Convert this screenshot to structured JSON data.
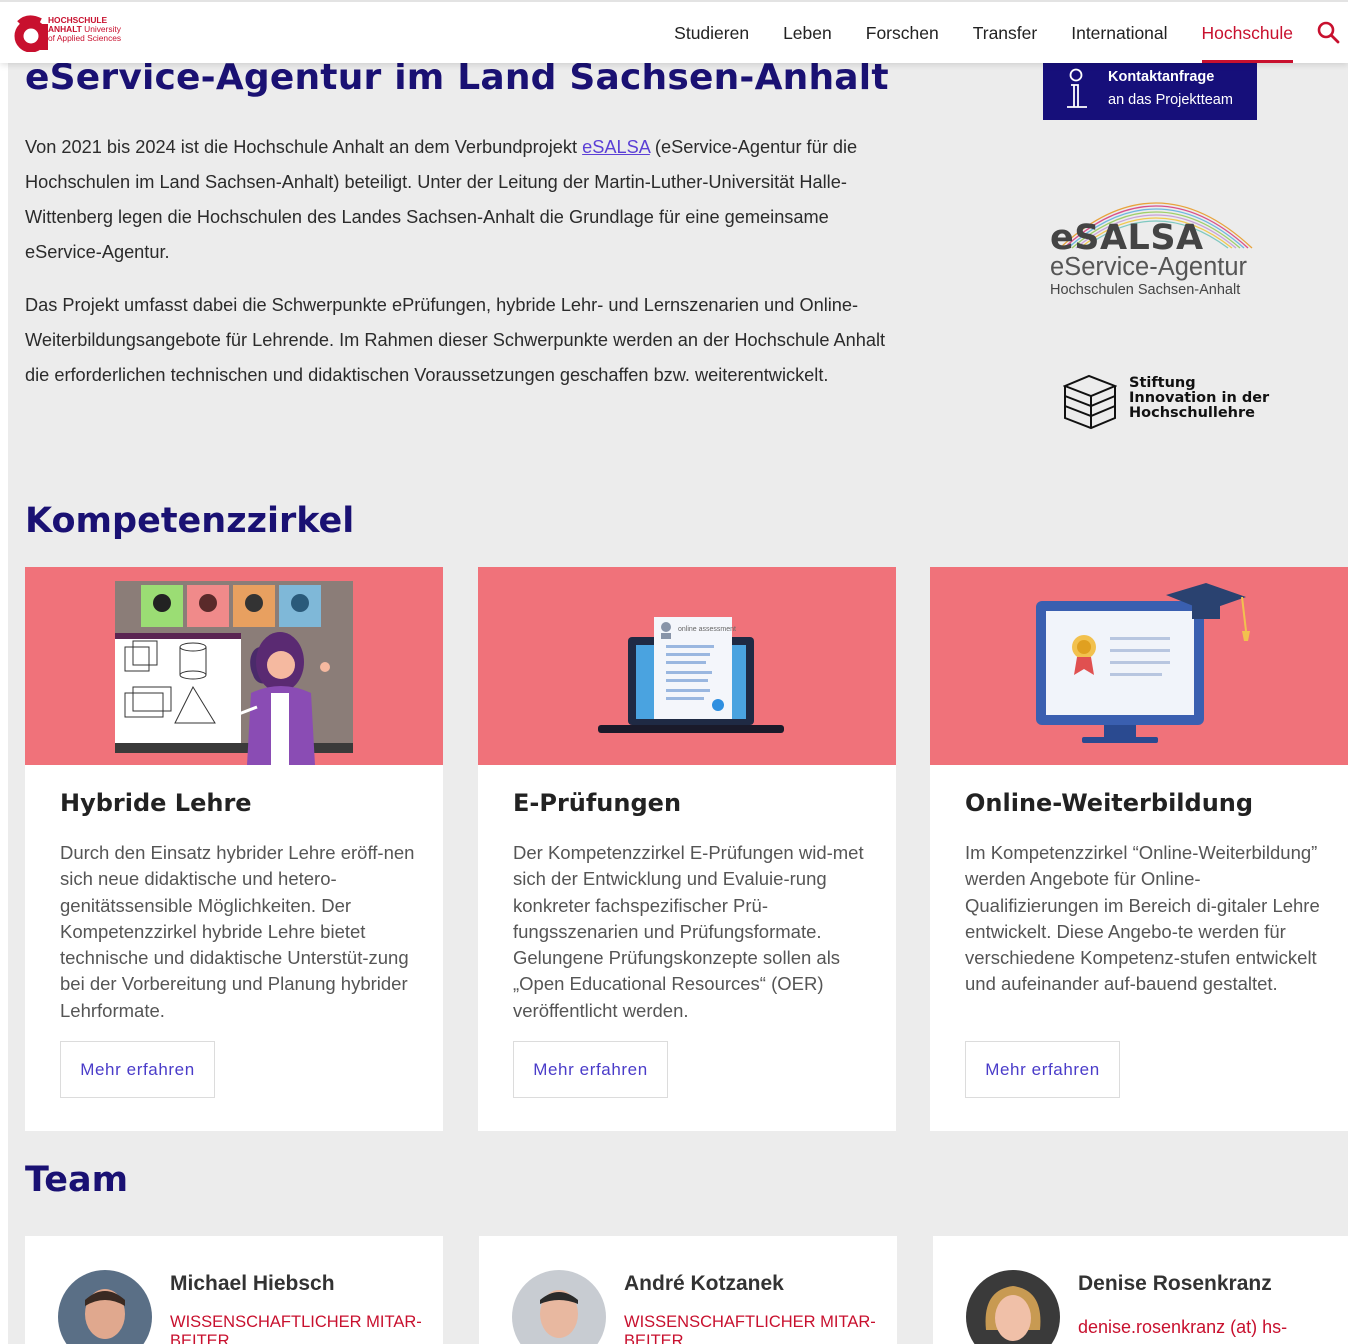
{
  "header": {
    "logo": {
      "line1": "HOCHSCHULE",
      "line2_bold": "ANHALT",
      "line2_rest": " University",
      "line3": "of Applied Sciences"
    },
    "nav": [
      {
        "label": "Studieren",
        "active": false
      },
      {
        "label": "Leben",
        "active": false
      },
      {
        "label": "Forschen",
        "active": false
      },
      {
        "label": "Transfer",
        "active": false
      },
      {
        "label": "International",
        "active": false
      },
      {
        "label": "Hochschule",
        "active": true
      }
    ],
    "search_icon": "search-icon"
  },
  "page": {
    "title": "eService-Agentur im Land Sachsen-Anhalt",
    "intro_p1_before": "Von 2021 bis 2024 ist die Hochschule Anhalt an dem Verbundprojekt ",
    "intro_p1_link": "eSALSA",
    "intro_p1_after": " (eService-Agentur für die Hochschulen im Land Sachsen-Anhalt) beteiligt. Unter der Leitung der Martin-Luther-Universität Halle-Wittenberg legen die Hochschulen des Landes Sachsen-Anhalt die Grundlage für eine gemeinsame eService-Agentur.",
    "intro_p2": "Das Projekt umfasst dabei die Schwerpunkte ePrüfungen, hybride Lehr- und Lernszenarien und Online-Weiterbildungsangebote für Lehrende. Im Rahmen dieser Schwerpunkte werden an der Hochschule Anhalt die erforderlichen technischen und didaktischen Voraussetzungen geschaffen bzw. weiterentwickelt."
  },
  "sidebar": {
    "contact_line1": "Kontaktanfrage",
    "contact_line2": "an das Projektteam",
    "esalsa_name": "eSALSA",
    "esalsa_sub": "eService-Agentur",
    "esalsa_sub2": "Hochschulen Sachsen-Anhalt",
    "stiftung_l1": "Stiftung",
    "stiftung_l2": "Innovation in der",
    "stiftung_l3": "Hochschullehre"
  },
  "kompetenz": {
    "title": "Kompetenzzirkel",
    "assessment_label": "online assessment",
    "cards": [
      {
        "title": "Hybride Lehre",
        "text": "Durch den Einsatz hybrider Lehre eröff-nen sich neue didaktische und hetero-genitätssensible Möglichkeiten. Der Kompetenzzirkel hybride Lehre bietet technische und didaktische Unterstüt-zung bei der Vorbereitung und Planung hybrider Lehrformate.",
        "button": "Mehr erfahren"
      },
      {
        "title": "E-Prüfungen",
        "text": "Der Kompetenzzirkel E-Prüfungen wid-met sich der Entwicklung und Evaluie-rung konkreter fachspezifischer Prü-fungsszenarien und Prüfungsformate. Gelungene Prüfungskonzepte sollen als „Open Educational Resources“ (OER) veröffentlicht werden.",
        "button": "Mehr erfahren"
      },
      {
        "title": "Online-Weiterbildung",
        "text": "Im Kompetenzzirkel “Online-Weiterbildung” werden Angebote für Online-Qualifizierungen im Bereich di-gitaler Lehre entwickelt. Diese Angebo-te werden für verschiedene Kompetenz-stufen entwickelt und aufeinander auf-bauend gestaltet.",
        "button": "Mehr erfahren"
      }
    ]
  },
  "team": {
    "title": "Team",
    "members": [
      {
        "name": "Michael Hiebsch",
        "role": "WISSENSCHAFTLICHER MITAR-BEITER"
      },
      {
        "name": "André Kotzanek",
        "role": "WISSENSCHAFTLICHER MITAR-BEITER"
      },
      {
        "name": "Denise Rosenkranz",
        "email": "denise.rosenkranz (at) hs-"
      }
    ]
  },
  "colors": {
    "brand_red": "#c8102e",
    "navy": "#1a1173",
    "card_image_bg": "#f0727a",
    "panel_bg": "#ececec"
  }
}
